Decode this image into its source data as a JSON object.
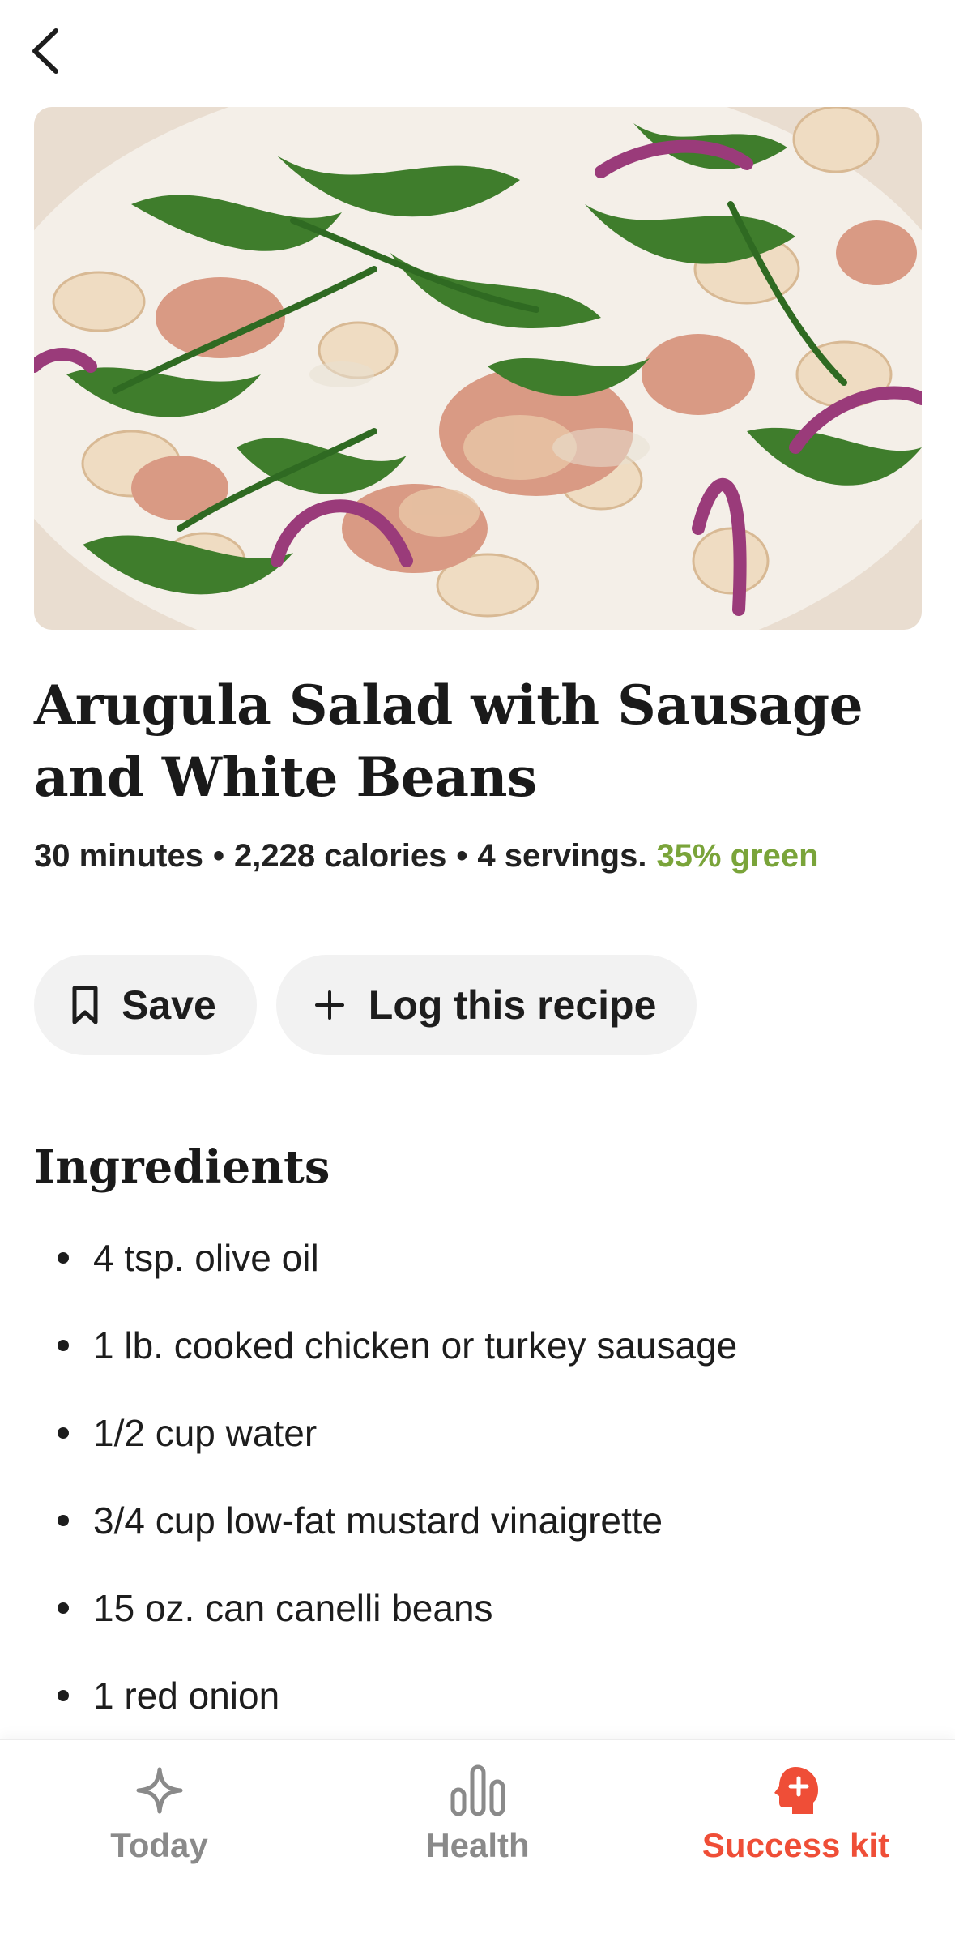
{
  "nav": {
    "back_icon": "chevron-left-icon"
  },
  "hero": {
    "image": "photo of arugula salad with white beans, sausage and red onion"
  },
  "recipe": {
    "title": "Arugula Salad with Sausage and White Beans",
    "time": "30 minutes",
    "calories": "2,228 calories",
    "servings": "4 servings.",
    "green": "35% green",
    "separator": "•"
  },
  "actions": {
    "save_label": "Save",
    "save_icon": "bookmark-icon",
    "log_label": "Log this recipe",
    "log_icon": "plus-icon"
  },
  "ingredients": {
    "heading": "Ingredients",
    "items": [
      "4 tsp. olive oil",
      "1 lb. cooked chicken or turkey sausage",
      "1/2 cup water",
      "3/4 cup low-fat mustard vinaigrette",
      "15 oz. can canelli beans",
      "1 red onion"
    ]
  },
  "tabbar": {
    "tabs": [
      {
        "label": "Today",
        "icon": "sparkle-icon",
        "active": false
      },
      {
        "label": "Health",
        "icon": "bar-chart-icon",
        "active": false
      },
      {
        "label": "Success kit",
        "icon": "head-plus-icon",
        "active": true
      }
    ]
  },
  "colors": {
    "accent": "#ef4e37",
    "green": "#7aa43a",
    "inactive": "#8a8a8a",
    "pill_bg": "#f2f2f2"
  }
}
